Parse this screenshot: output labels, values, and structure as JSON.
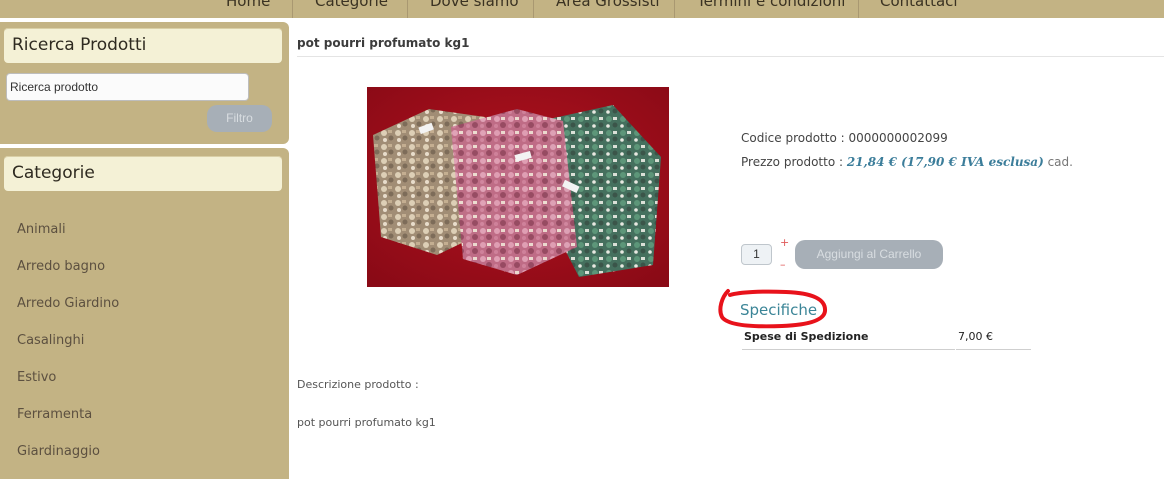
{
  "nav": {
    "items": [
      "Home",
      "Categorie",
      "Dove siamo",
      "Area Grossisti",
      "Termini e condizioni",
      "Contattaci"
    ]
  },
  "search_panel": {
    "title": "Ricerca Prodotti",
    "input_value": "Ricerca prodotto",
    "filter_label": "Filtro"
  },
  "category_panel": {
    "title": "Categorie",
    "items": [
      "Animali",
      "Arredo bagno",
      "Arredo Giardino",
      "Casalinghi",
      "Estivo",
      "Ferramenta",
      "Giardinaggio"
    ]
  },
  "product": {
    "title": "pot pourri profumato kg1",
    "code_label": "Codice prodotto : ",
    "code_value": "0000000002099",
    "price_label": "Prezzo prodotto : ",
    "price_value": "21,84 € (17,90 € IVA esclusa)",
    "price_unit": " cad.",
    "quantity": "1",
    "qty_plus": "+",
    "qty_minus": "–",
    "add_to_cart_label": "Aggiungi al Carrello",
    "specs_title": "Specifiche",
    "specs": [
      {
        "label": "Spese di Spedizione",
        "value": "7,00 €"
      }
    ],
    "description_label": "Descrizione prodotto :",
    "description_text": "pot pourri profumato kg1"
  },
  "colors": {
    "sidebar": "#c3b384",
    "panel_title_bg": "#f4f1d6",
    "accent_price": "#3b7d9a",
    "specs_link": "#3b8597",
    "annotation_circle": "#e8121b",
    "button_disabled": "#a7afb7"
  }
}
